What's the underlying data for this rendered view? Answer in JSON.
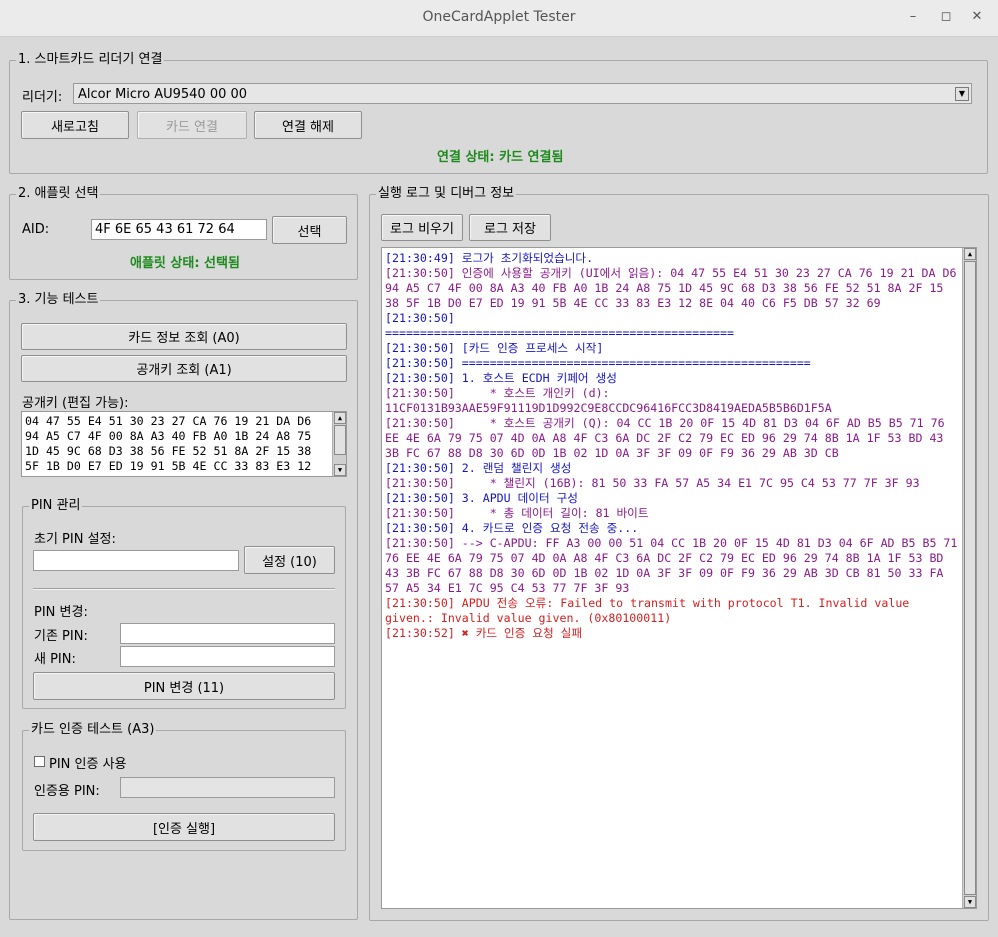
{
  "window": {
    "title": "OneCardApplet Tester"
  },
  "reader_section": {
    "legend": "1. 스마트카드 리더기 연결",
    "reader_label": "리더기:",
    "reader_value": "Alcor Micro AU9540 00 00",
    "refresh_label": "새로고침",
    "connect_label": "카드 연결",
    "disconnect_label": "연결 해제",
    "status": "연결 상태: 카드 연결됨"
  },
  "applet_section": {
    "legend": "2. 애플릿 선택",
    "aid_label": "AID:",
    "aid_value": "4F 6E 65 43 61 72 64",
    "select_label": "선택",
    "status": "애플릿 상태: 선택됨"
  },
  "function_section": {
    "legend": "3. 기능 테스트",
    "card_info_label": "카드 정보 조회 (A0)",
    "pubkey_label": "공개키 조회 (A1)",
    "pubkey_edit_label": "공개키 (편집 가능):",
    "pubkey_lines": [
      "04 47 55 E4 51 30 23 27 CA 76 19 21 DA D6",
      "94 A5 C7 4F 00 8A A3 40 FB A0 1B 24 A8 75",
      "1D 45 9C 68 D3 38 56 FE 52 51 8A 2F 15 38",
      "5F 1B D0 E7 ED 19 91 5B 4E CC 33 83 E3 12"
    ]
  },
  "pin_section": {
    "legend": "PIN 관리",
    "init_label": "초기 PIN 설정:",
    "init_value": "",
    "set_label": "설정 (10)",
    "change_label": "PIN 변경:",
    "old_pin_label": "기존 PIN:",
    "new_pin_label": "새 PIN:",
    "change_button_label": "PIN 변경 (11)"
  },
  "auth_section": {
    "legend": "카드 인증 테스트 (A3)",
    "use_pin_label": "PIN 인증 사용",
    "auth_pin_label": "인증용 PIN:",
    "run_label": "[인증 실행]"
  },
  "log_section": {
    "legend": "실행 로그 및 디버그 정보",
    "clear_label": "로그 비우기",
    "save_label": "로그 저장",
    "lines": [
      {
        "text": "[21:30:49] 로그가 초기화되었습니다.",
        "color": "blue"
      },
      {
        "text": "[21:30:50] 인증에 사용할 공개키 (UI에서 읽음): 04 47 55 E4 51 30 23 27 CA 76 19 21 DA D6",
        "color": "purple"
      },
      {
        "text": "94 A5 C7 4F 00 8A A3 40 FB A0 1B 24 A8 75 1D 45 9C 68 D3 38 56 FE 52 51 8A 2F 15",
        "color": "purple"
      },
      {
        "text": "38 5F 1B D0 E7 ED 19 91 5B 4E CC 33 83 E3 12 8E 04 40 C6 F5 DB 57 32 69",
        "color": "purple"
      },
      {
        "text": "[21:30:50]",
        "color": "blue"
      },
      {
        "text": "==================================================",
        "color": "blue"
      },
      {
        "text": "[21:30:50] [카드 인증 프로세스 시작]",
        "color": "blue"
      },
      {
        "text": "[21:30:50] ==================================================",
        "color": "blue"
      },
      {
        "text": "[21:30:50] 1. 호스트 ECDH 키페어 생성",
        "color": "blue"
      },
      {
        "text": "[21:30:50]     * 호스트 개인키 (d):",
        "color": "purple"
      },
      {
        "text": "11CF0131B93AAE59F91119D1D992C9E8CCDC96416FCC3D8419AEDA5B5B6D1F5A",
        "color": "purple"
      },
      {
        "text": "[21:30:50]     * 호스트 공개키 (Q): 04 CC 1B 20 0F 15 4D 81 D3 04 6F AD B5 B5 71 76",
        "color": "purple"
      },
      {
        "text": "EE 4E 6A 79 75 07 4D 0A A8 4F C3 6A DC 2F C2 79 EC ED 96 29 74 8B 1A 1F 53 BD 43",
        "color": "purple"
      },
      {
        "text": "3B FC 67 88 D8 30 6D 0D 1B 02 1D 0A 3F 3F 09 0F F9 36 29 AB 3D CB",
        "color": "purple"
      },
      {
        "text": "[21:30:50] 2. 랜덤 챌린지 생성",
        "color": "blue"
      },
      {
        "text": "[21:30:50]     * 챌린지 (16B): 81 50 33 FA 57 A5 34 E1 7C 95 C4 53 77 7F 3F 93",
        "color": "purple"
      },
      {
        "text": "[21:30:50] 3. APDU 데이터 구성",
        "color": "blue"
      },
      {
        "text": "[21:30:50]     * 총 데이터 길이: 81 바이트",
        "color": "purple"
      },
      {
        "text": "[21:30:50] 4. 카드로 인증 요청 전송 중...",
        "color": "blue"
      },
      {
        "text": "[21:30:50] --> C-APDU: FF A3 00 00 51 04 CC 1B 20 0F 15 4D 81 D3 04 6F AD B5 B5 71",
        "color": "purple"
      },
      {
        "text": "76 EE 4E 6A 79 75 07 4D 0A A8 4F C3 6A DC 2F C2 79 EC ED 96 29 74 8B 1A 1F 53 BD",
        "color": "purple"
      },
      {
        "text": "43 3B FC 67 88 D8 30 6D 0D 1B 02 1D 0A 3F 3F 09 0F F9 36 29 AB 3D CB 81 50 33 FA",
        "color": "purple"
      },
      {
        "text": "57 A5 34 E1 7C 95 C4 53 77 7F 3F 93",
        "color": "purple"
      },
      {
        "text": "[21:30:50] APDU 전송 오류: Failed to transmit with protocol T1. Invalid value",
        "color": "red"
      },
      {
        "text": "given.: Invalid value given. (0x80100011)",
        "color": "red"
      },
      {
        "text": "[21:30:52] ✖ 카드 인증 요청 실패",
        "color": "red"
      }
    ]
  }
}
